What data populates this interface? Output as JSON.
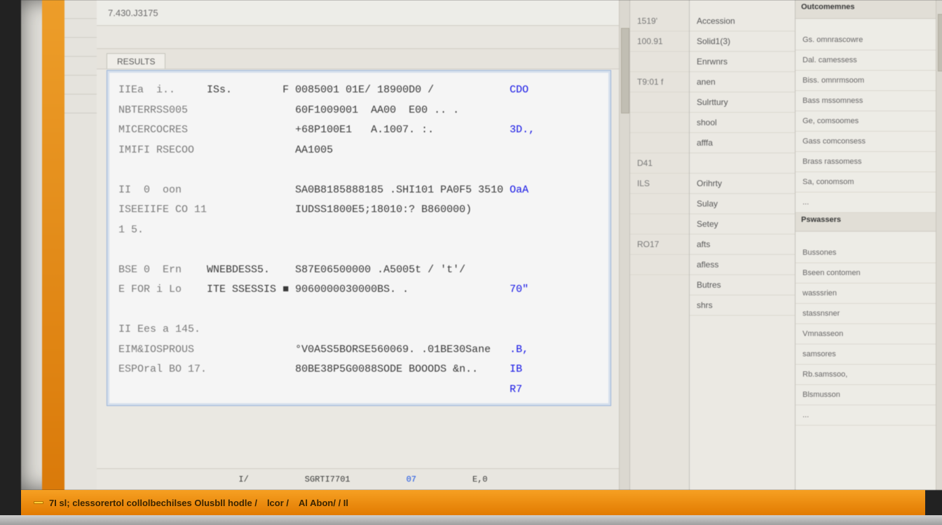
{
  "titlebar": {
    "doc_id": "7.430.J3175"
  },
  "tabs": {
    "active": "RESULTS"
  },
  "editor": {
    "lines": [
      {
        "col1": "IIEa  i..",
        "col2": "ISs.",
        "col3": "F",
        "col4": "0085001 01E/ 18900D0 /",
        "col5": "CDO"
      },
      {
        "col1": "NBTERRSS005",
        "col2": "",
        "col3": "",
        "col4": "60F1009001  AA00  E00 .. .",
        "col5": ""
      },
      {
        "col1": "MICERCOCRES",
        "col2": "",
        "col3": "",
        "col4": "+68P100E1   A.1007. :.",
        "col5": "3D.,"
      },
      {
        "col1": "IMIFI RSECOO",
        "col2": "",
        "col3": "",
        "col4": "AA1005",
        "col5": ""
      },
      {
        "col1": "",
        "col2": "",
        "col3": "",
        "col4": "",
        "col5": ""
      },
      {
        "col1": "II  0  oon",
        "col2": "",
        "col3": "",
        "col4": "SA0B8185888185 .SHI101 PA0F5 3510",
        "col5": "OaA"
      },
      {
        "col1": "ISEEIIFE CO 11",
        "col2": "",
        "col3": "",
        "col4": "IUDSS1800E5;18010:? B860000)",
        "col5": ""
      },
      {
        "col1": "1 5.",
        "col2": "",
        "col3": "",
        "col4": "",
        "col5": ""
      },
      {
        "col1": "",
        "col2": "",
        "col3": "",
        "col4": "",
        "col5": ""
      },
      {
        "col1": "BSE 0  Ern",
        "col2": "WNEBDESS5.",
        "col3": "",
        "col4": "S87E06500000 .A5005t / 't'/",
        "col5": ""
      },
      {
        "col1": "E FOR i Lo",
        "col2": "ITE SSESSIS",
        "col3": "■",
        "col4": "9060000030000BS. .",
        "col5": "70\""
      },
      {
        "col1": "",
        "col2": "",
        "col3": "",
        "col4": "",
        "col5": ""
      },
      {
        "col1": "II Ees a 145.",
        "col2": "",
        "col3": "",
        "col4": "",
        "col5": ""
      },
      {
        "col1": "EIM&IOSPROUS",
        "col2": "",
        "col3": "",
        "col4": "°V0A5S5BORSE560069. .01BE30Sane",
        "col5": ".B,"
      },
      {
        "col1": "ESPOral BO 17.",
        "col2": "",
        "col3": "",
        "col4": "80BE38P5G0088SODE BOOODS &n..",
        "col5": "IB"
      },
      {
        "col1": "",
        "col2": "",
        "col3": "",
        "col4": "",
        "col5": "R7"
      }
    ]
  },
  "statusbar": {
    "left": "I/",
    "mid": "SGRTI7701",
    "right_num": "07",
    "right_code": "E,0"
  },
  "right_panel": {
    "narrow": [
      "1519'",
      "100.91",
      "",
      "T9:01 f",
      "",
      "",
      "",
      "D41",
      "ILS",
      "",
      "",
      "RO17",
      ""
    ],
    "mid": [
      "Accession",
      "Solid1(3)",
      "Enrwnrs",
      "anen",
      "Sulrttury",
      "shool",
      "afffa",
      "",
      "Orihrty",
      "Sulay",
      "Setey",
      "afts",
      "afless",
      "Butres",
      "shrs"
    ],
    "wide": {
      "section_a": "Outcomemnes",
      "items_a": [
        "Gs.  omnrascowre",
        "Dal.  camessess",
        "Biss.  omnrmsoom",
        "Bass  mssomness",
        "Ge,  comsoomes",
        "Gass  comconsess",
        "Brass  rassomess",
        "Sa,  conomsom",
        "..."
      ],
      "section_b": "Pswassers",
      "items_b": [
        "Bussones",
        "Bseen  contomen",
        "wasssrien",
        "stassnsner",
        "Vmnasseon",
        "samsores",
        "Rb.samssoo,",
        "Blsmusson",
        "..."
      ]
    }
  },
  "taskbar": {
    "items": [
      "7I sl; clessorertol collolbechilses Olusbll hodle /",
      "lcor /",
      "Al Abon/ / Il"
    ]
  }
}
